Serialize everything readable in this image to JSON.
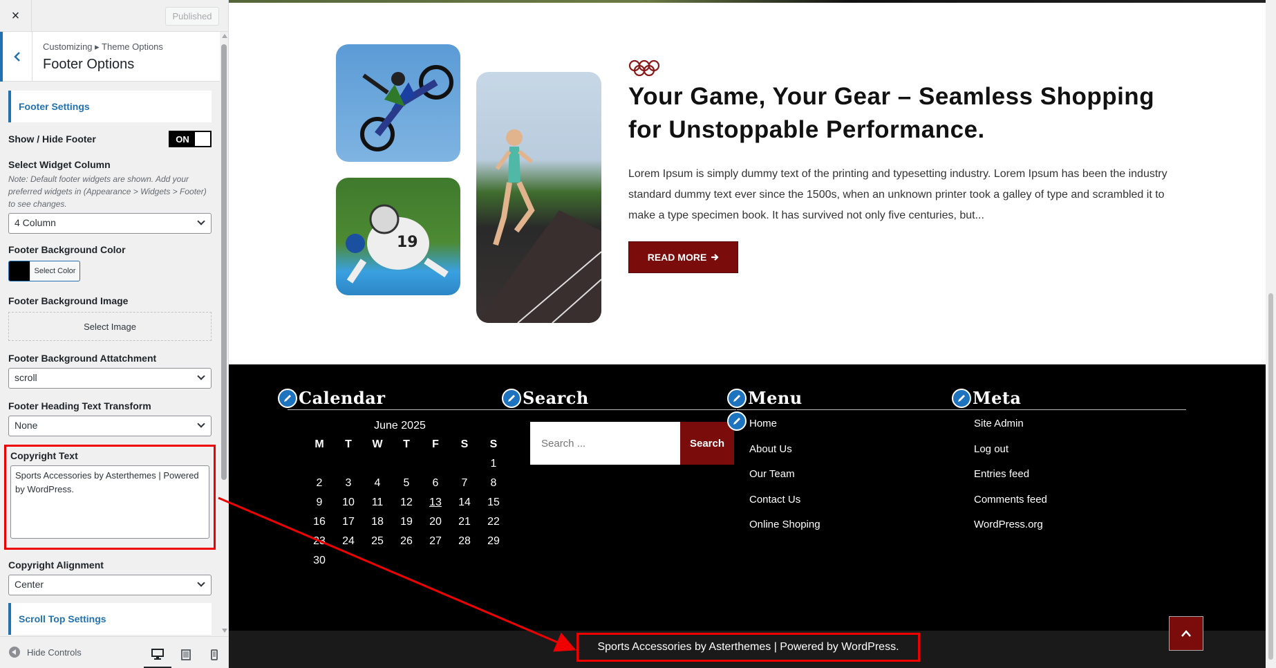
{
  "customizer": {
    "close_label": "×",
    "publish_label": "Published",
    "breadcrumb": "Customizing ▸ Theme Options",
    "section_title": "Footer Options",
    "footer_settings_heading": "Footer Settings",
    "show_hide_footer_label": "Show / Hide Footer",
    "toggle_on_label": "ON",
    "widget_column_label": "Select Widget Column",
    "widget_column_note": "Note: Default footer widgets are shown. Add your preferred widgets in (Appearance > Widgets > Footer) to see changes.",
    "widget_column_value": "4 Column",
    "bg_color_label": "Footer Background Color",
    "bg_color_button": "Select Color",
    "bg_color_value": "#000000",
    "bg_image_label": "Footer Background Image",
    "bg_image_button": "Select Image",
    "bg_attachment_label": "Footer Background Attatchment",
    "bg_attachment_value": "scroll",
    "heading_transform_label": "Footer Heading Text Transform",
    "heading_transform_value": "None",
    "copyright_label": "Copyright Text",
    "copyright_value": "Sports Accessories by Asterthemes | Powered by WordPress.",
    "copyright_alignment_label": "Copyright Alignment",
    "copyright_alignment_value": "Center",
    "scroll_top_heading": "Scroll Top Settings",
    "hide_controls_label": "Hide Controls",
    "devices": [
      "desktop-icon",
      "tablet-icon",
      "mobile-icon"
    ]
  },
  "preview": {
    "hero": {
      "title": "Your Game, Your Gear – Seamless Shopping for Unstoppable Performance.",
      "text": "Lorem Ipsum is simply dummy text of the printing and typesetting industry. Lorem Ipsum has been the industry standard dummy text ever since the 1500s, when an unknown printer took a galley of type and scrambled it to make a type specimen book. It has survived not only five centuries, but...",
      "read_more": "READ MORE",
      "accent_color": "#7a0c0c"
    },
    "calendar": {
      "title": "Calendar",
      "caption": "June 2025",
      "weekdays": [
        "M",
        "T",
        "W",
        "T",
        "F",
        "S",
        "S"
      ],
      "weeks": [
        [
          "",
          "",
          "",
          "",
          "",
          "",
          "1"
        ],
        [
          "2",
          "3",
          "4",
          "5",
          "6",
          "7",
          "8"
        ],
        [
          "9",
          "10",
          "11",
          "12",
          "13",
          "14",
          "15"
        ],
        [
          "16",
          "17",
          "18",
          "19",
          "20",
          "21",
          "22"
        ],
        [
          "23",
          "24",
          "25",
          "26",
          "27",
          "28",
          "29"
        ],
        [
          "30",
          "",
          "",
          "",
          "",
          "",
          ""
        ]
      ],
      "today": "13"
    },
    "search": {
      "title": "Search",
      "placeholder": "Search ...",
      "button": "Search"
    },
    "menu": {
      "title": "Menu",
      "items": [
        "Home",
        "About Us",
        "Our Team",
        "Contact Us",
        "Online Shoping"
      ]
    },
    "meta": {
      "title": "Meta",
      "items": [
        "Site Admin",
        "Log out",
        "Entries feed",
        "Comments feed",
        "WordPress.org"
      ]
    },
    "copyright": "Sports Accessories by Asterthemes | Powered by WordPress."
  }
}
